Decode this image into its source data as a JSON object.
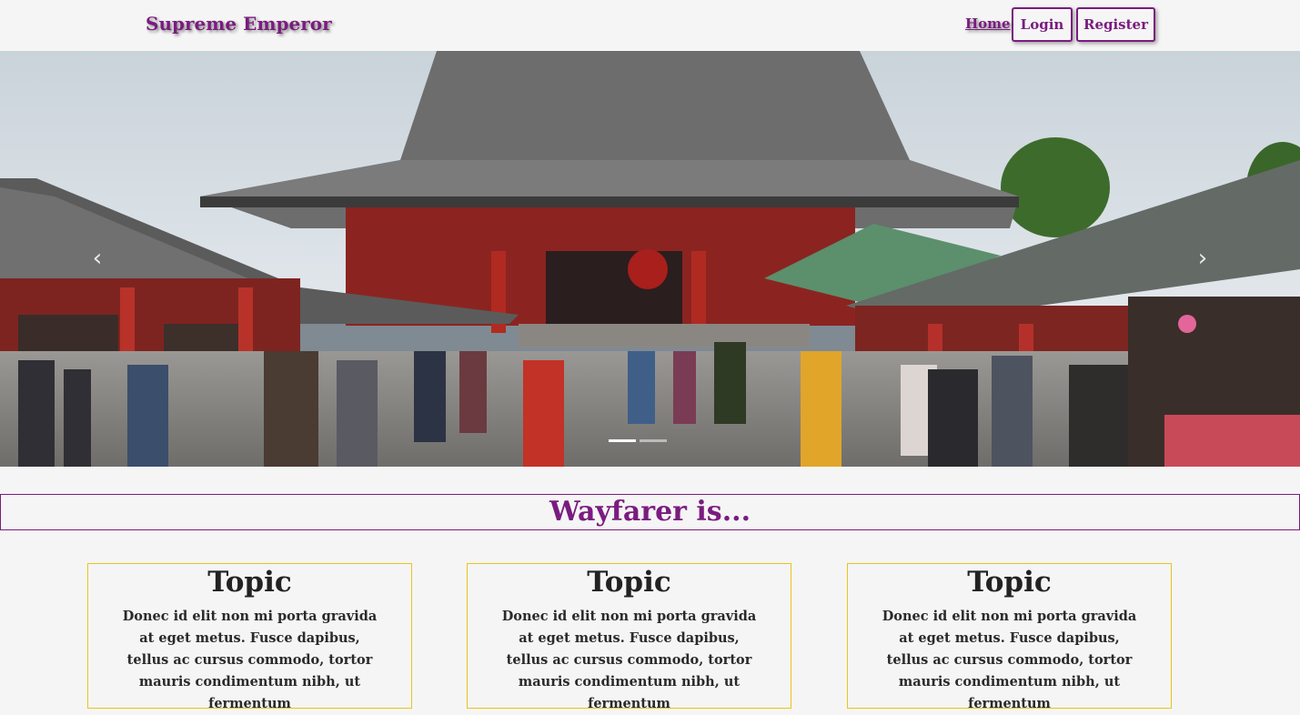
{
  "navbar": {
    "brand": "Supreme Emperor",
    "home": "Home",
    "login": "Login",
    "register": "Register"
  },
  "hero": {
    "image_subject": "temple courtyard with crowd",
    "prev_icon": "chevron-left-icon",
    "next_icon": "chevron-right-icon",
    "prev_glyph": "‹",
    "next_glyph": "›",
    "indicator_count": 2,
    "active_indicator": 0
  },
  "section": {
    "heading": "Wayfarer is..."
  },
  "cards": [
    {
      "title": "Topic",
      "body": "Donec id elit non mi porta gravida at eget metus. Fusce dapibus, tellus ac cursus commodo, tortor mauris condimentum nibh, ut fermentum"
    },
    {
      "title": "Topic",
      "body": "Donec id elit non mi porta gravida at eget metus. Fusce dapibus, tellus ac cursus commodo, tortor mauris condimentum nibh, ut fermentum"
    },
    {
      "title": "Topic",
      "body": "Donec id elit non mi porta gravida at eget metus. Fusce dapibus, tellus ac cursus commodo, tortor mauris condimentum nibh, ut fermentum"
    }
  ],
  "colors": {
    "accent": "#7a1c7f",
    "card_border": "#e8c420",
    "background": "#f5f5f5"
  }
}
